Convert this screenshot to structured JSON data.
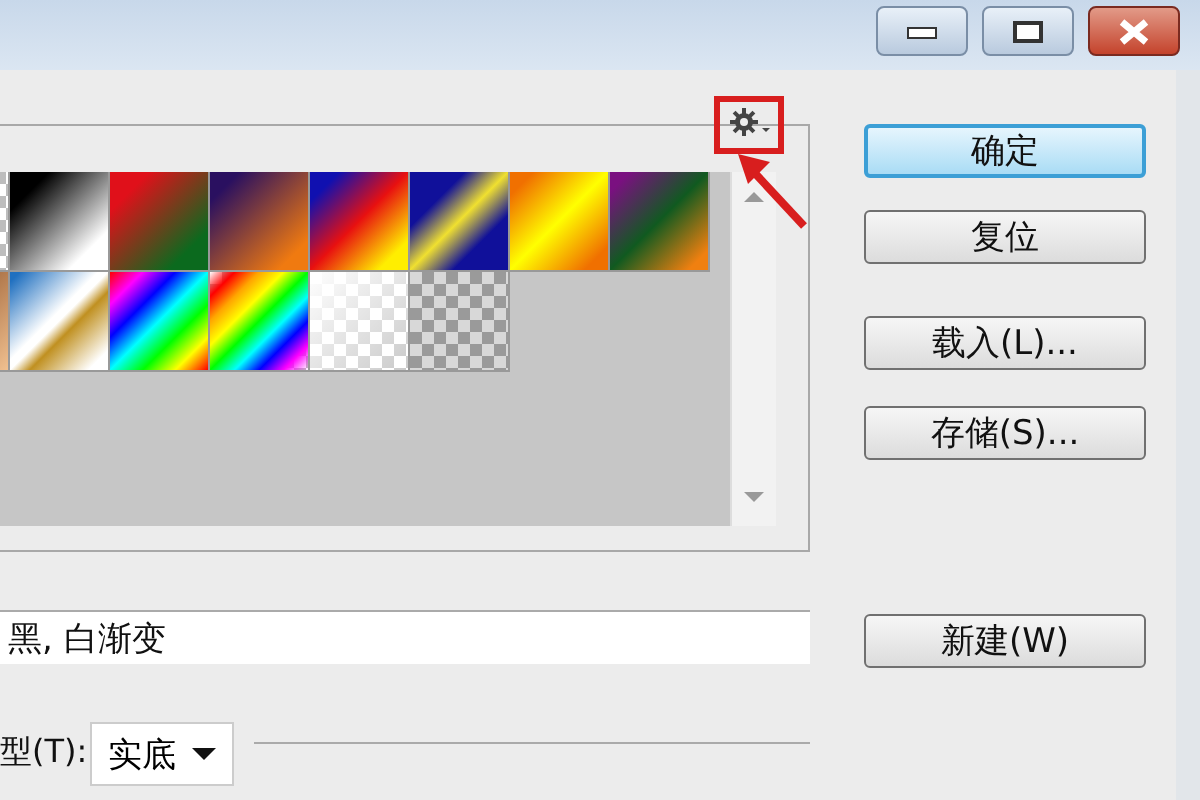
{
  "buttons": [
    {
      "label": "确定",
      "default": true
    },
    {
      "label": "复位",
      "default": false
    },
    {
      "label": "载入(L)...",
      "default": false
    },
    {
      "label": "存储(S)...",
      "default": false
    }
  ],
  "name_field": {
    "value": "黑, 白渐变"
  },
  "new_button": {
    "label": "新建(W)"
  },
  "gradient_type": {
    "label": "型(T):",
    "value": "实底"
  }
}
